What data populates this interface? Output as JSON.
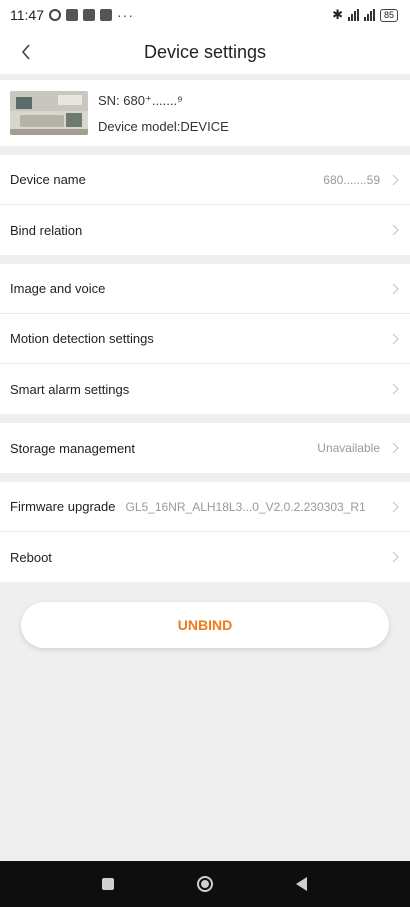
{
  "status_bar": {
    "time": "11:47",
    "dots": "···",
    "battery": "85",
    "icons": [
      "alarm-icon",
      "notification-icon",
      "bluetooth-icon",
      "signal-icon",
      "battery-icon"
    ]
  },
  "header": {
    "title": "Device settings",
    "back_icon": "chevron-left-icon"
  },
  "device": {
    "sn": "SN: 680⁺.......⁹",
    "model": "Device model:DEVICE"
  },
  "rows": {
    "device_name": {
      "label": "Device name",
      "value": "680.......59"
    },
    "bind_relation": {
      "label": "Bind relation"
    },
    "image_voice": {
      "label": "Image and voice"
    },
    "motion": {
      "label": "Motion detection settings"
    },
    "smart_alarm": {
      "label": "Smart alarm settings"
    },
    "storage": {
      "label": "Storage management",
      "value": "Unavailable"
    },
    "firmware": {
      "label": "Firmware upgrade",
      "value": "GL5_16NR_ALH18L3...0_V2.0.2.230303_R1"
    },
    "reboot": {
      "label": "Reboot"
    }
  },
  "actions": {
    "unbind_label": "UNBIND"
  },
  "colors": {
    "accent": "#f07a1a",
    "background": "#efefef",
    "nav_bar": "#0e0e0e"
  }
}
